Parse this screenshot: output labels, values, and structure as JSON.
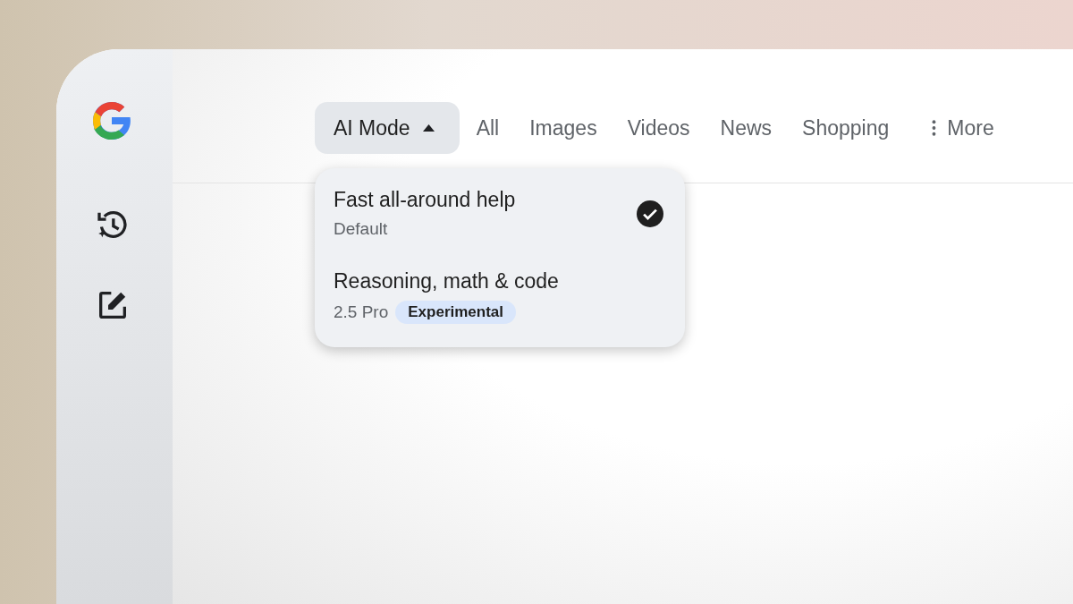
{
  "tabs": [
    {
      "label": "AI Mode",
      "selected": true,
      "kind": "dropdown",
      "expanded": true
    },
    {
      "label": "All",
      "selected": false,
      "kind": "tab"
    },
    {
      "label": "Images",
      "selected": false,
      "kind": "tab"
    },
    {
      "label": "Videos",
      "selected": false,
      "kind": "tab"
    },
    {
      "label": "News",
      "selected": false,
      "kind": "tab"
    },
    {
      "label": "Shopping",
      "selected": false,
      "kind": "tab"
    },
    {
      "label": "More",
      "selected": false,
      "kind": "more"
    }
  ],
  "menu": {
    "items": [
      {
        "title": "Fast all-around help",
        "subtitle": "Default",
        "checked": true
      },
      {
        "title": "Reasoning, math & code",
        "subtitle": "2.5 Pro",
        "badge": "Experimental",
        "checked": false
      }
    ]
  }
}
